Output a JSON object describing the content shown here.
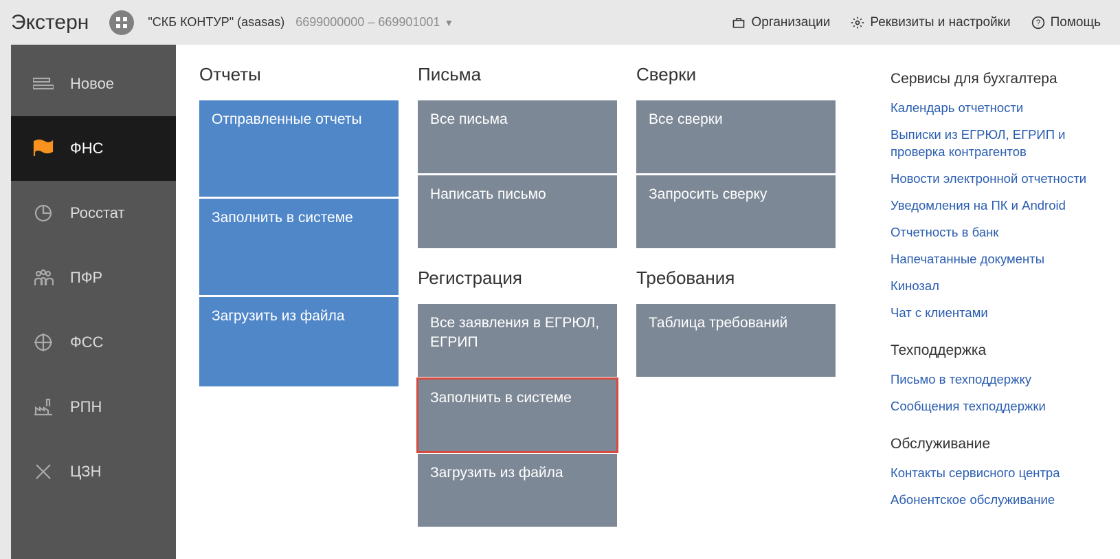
{
  "header": {
    "logo": "Экстерн",
    "org_name": "\"СКБ КОНТУР\" (asasas)",
    "org_codes": "6699000000 – 669901001",
    "links": {
      "orgs": "Организации",
      "settings": "Реквизиты и настройки",
      "help": "Помощь"
    }
  },
  "sidebar": {
    "items": [
      {
        "label": "Новое"
      },
      {
        "label": "ФНС"
      },
      {
        "label": "Росстат"
      },
      {
        "label": "ПФР"
      },
      {
        "label": "ФСС"
      },
      {
        "label": "РПН"
      },
      {
        "label": "ЦЗН"
      }
    ]
  },
  "columns": {
    "reports": {
      "title": "Отчеты",
      "tiles": [
        "Отправленные отчеты",
        "Заполнить в системе",
        "Загрузить из файла"
      ]
    },
    "letters": {
      "title": "Письма",
      "tiles": [
        "Все письма",
        "Написать письмо"
      ]
    },
    "registration": {
      "title": "Регистрация",
      "tiles": [
        "Все заявления в ЕГРЮЛ, ЕГРИП",
        "Заполнить в системе",
        "Загрузить из файла"
      ]
    },
    "checks": {
      "title": "Сверки",
      "tiles": [
        "Все сверки",
        "Запросить сверку"
      ]
    },
    "demands": {
      "title": "Требования",
      "tiles": [
        "Таблица требований"
      ]
    }
  },
  "right": {
    "s1": {
      "title": "Сервисы для бухгалтера",
      "links": [
        "Календарь отчетности",
        "Выписки из ЕГРЮЛ, ЕГРИП и проверка контрагентов",
        "Новости электронной отчетности",
        "Уведомления на ПК и Android",
        "Отчетность в банк",
        "Напечатанные документы",
        "Кинозал",
        "Чат с клиентами"
      ]
    },
    "s2": {
      "title": "Техподдержка",
      "links": [
        "Письмо в техподдержку",
        "Сообщения техподдержки"
      ]
    },
    "s3": {
      "title": "Обслуживание",
      "links": [
        "Контакты сервисного центра",
        "Абонентское обслуживание"
      ]
    }
  }
}
